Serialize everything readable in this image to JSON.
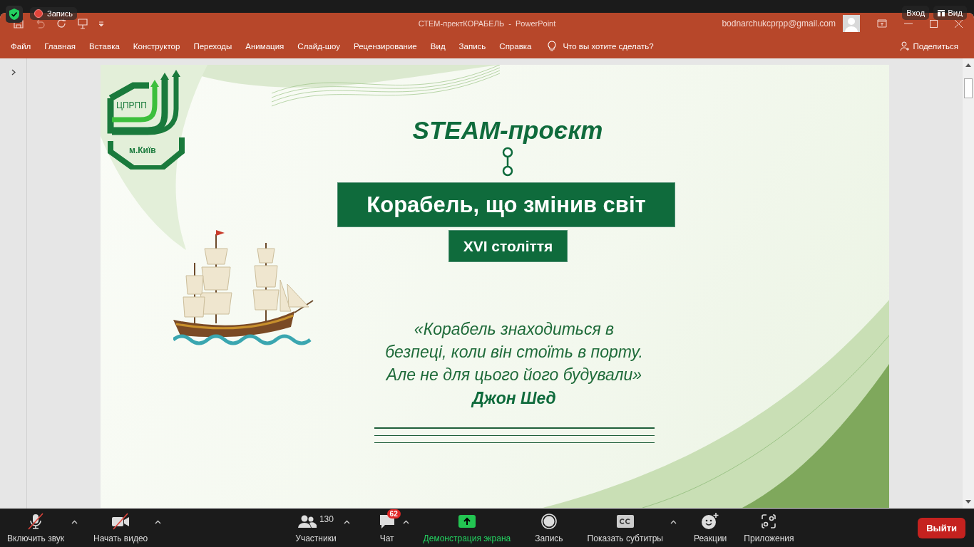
{
  "zoom_overlay": {
    "recording_label": "Запись",
    "top_buttons": [
      {
        "kind": "signin",
        "label": "Вход"
      },
      {
        "kind": "view",
        "label": "Вид"
      }
    ]
  },
  "window": {
    "title": "СТЕМ-пректКОРАБЕЛЬ  -  PowerPoint",
    "account": "bodnarchukcprpp@gmail.com"
  },
  "ribbon": {
    "tabs": [
      "Файл",
      "Главная",
      "Вставка",
      "Конструктор",
      "Переходы",
      "Анимация",
      "Слайд-шоу",
      "Рецензирование",
      "Вид",
      "Запись",
      "Справка"
    ],
    "tell_me": "Что вы хотите сделать?",
    "share": "Поделиться"
  },
  "slide": {
    "logo_top": "ЦПРПП",
    "logo_bottom": "м.Київ",
    "heading": "STEAM-проєкт",
    "title": "Корабель, що змінив світ",
    "subtitle": "XVI століття",
    "quote_lines": [
      "«Корабель знаходиться в",
      "безпеці, коли він стоїть в порту.",
      "Але не для цього його будували»"
    ],
    "author": "Джон Шед"
  },
  "toolbar": {
    "items": [
      {
        "kind": "mic",
        "label": "Включить звук",
        "off": true,
        "caret": true,
        "highlighted": false
      },
      {
        "kind": "video",
        "label": "Начать видео",
        "off": true,
        "caret": true,
        "highlighted": false
      },
      {
        "kind": "participants",
        "label": "Участники",
        "count": "130",
        "off": false,
        "caret": true,
        "highlighted": false
      },
      {
        "kind": "chat",
        "label": "Чат",
        "badge": "62",
        "off": false,
        "caret": true,
        "highlighted": false
      },
      {
        "kind": "share",
        "label": "Демонстрация экрана",
        "off": false,
        "caret": false,
        "highlighted": true
      },
      {
        "kind": "record",
        "label": "Запись",
        "off": false,
        "caret": false,
        "highlighted": false
      },
      {
        "kind": "captions",
        "label": "Показать субтитры",
        "off": false,
        "caret": true,
        "highlighted": false
      },
      {
        "kind": "reactions",
        "label": "Реакции",
        "off": false,
        "caret": false,
        "highlighted": false
      },
      {
        "kind": "apps",
        "label": "Приложения",
        "off": false,
        "caret": false,
        "highlighted": false
      }
    ],
    "leave": "Выйти"
  }
}
